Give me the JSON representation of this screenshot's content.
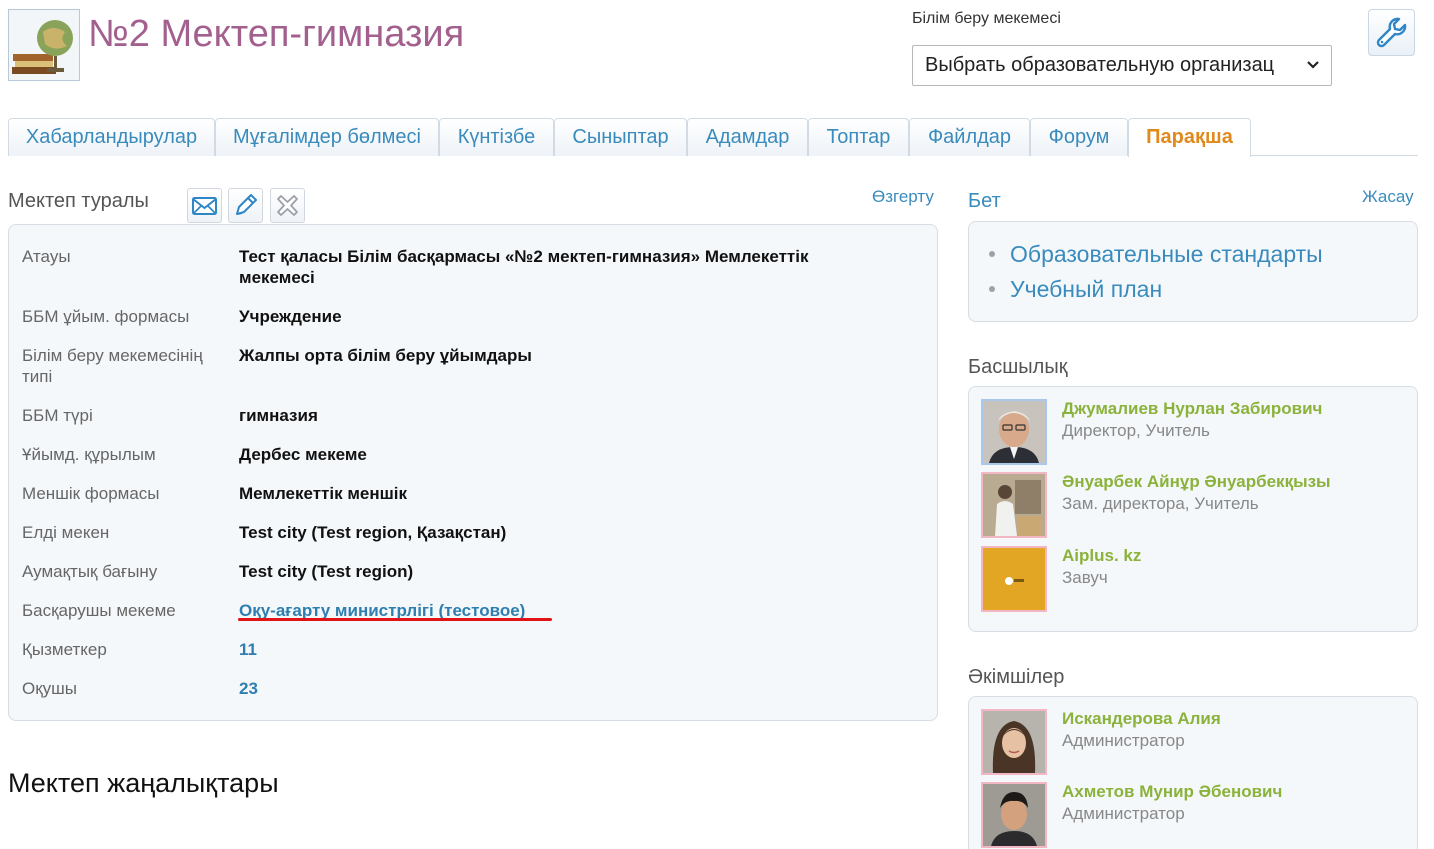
{
  "header": {
    "school_name": "№2 Мектеп-гимназия",
    "org_label": "Білім беру мекемесі",
    "org_select_value": "Выбрать образовательную организац"
  },
  "tabs": [
    {
      "label": "Хабарландырулар",
      "active": false
    },
    {
      "label": "Мұғалімдер бөлмесі",
      "active": false
    },
    {
      "label": "Күнтізбе",
      "active": false
    },
    {
      "label": "Сыныптар",
      "active": false
    },
    {
      "label": "Адамдар",
      "active": false
    },
    {
      "label": "Топтар",
      "active": false
    },
    {
      "label": "Файлдар",
      "active": false
    },
    {
      "label": "Форум",
      "active": false
    },
    {
      "label": "Парақша",
      "active": true
    }
  ],
  "school_info": {
    "title": "Мектеп туралы",
    "edit_label": "Өзгерту",
    "rows": [
      {
        "label": "Атауы",
        "value": "Тест қаласы Білім басқармасы «№2 мектеп-гимназия» Мемлекеттік мекемесі"
      },
      {
        "label": "ББМ ұйым. формасы",
        "value": "Учреждение"
      },
      {
        "label": "Білім беру мекемесінің типі",
        "value": "Жалпы орта білім беру ұйымдары"
      },
      {
        "label": "ББМ түрі",
        "value": "гимназия"
      },
      {
        "label": "Ұйымд. құрылым",
        "value": "Дербес мекеме"
      },
      {
        "label": "Меншік формасы",
        "value": "Мемлекеттік меншік"
      },
      {
        "label": "Елді мекен",
        "value": "Test city (Test region, Қазақстан)"
      },
      {
        "label": "Аумақтық бағыну",
        "value": "Test city (Test region)"
      },
      {
        "label": "Басқарушы мекеме",
        "value": "Оқу-ағарту министрлігі (тестовое)"
      },
      {
        "label": "Қызметкер",
        "value": "11"
      },
      {
        "label": "Оқушы",
        "value": "23"
      }
    ]
  },
  "news": {
    "title": "Мектеп жаңалықтары"
  },
  "pages": {
    "title": "Бет",
    "create_label": "Жасау",
    "items": [
      "Образовательные стандарты",
      "Учебный план"
    ]
  },
  "leadership": {
    "title": "Басшылық",
    "people": [
      {
        "name": "Джумалиев Нурлан Забирович",
        "role": "Директор, Учитель"
      },
      {
        "name": "Әнуарбек Айнұр Әнуарбекқызы",
        "role": "Зам. директора, Учитель"
      },
      {
        "name": "Aiplus. kz",
        "role": "Завуч"
      }
    ]
  },
  "admins": {
    "title": "Әкімшілер",
    "people": [
      {
        "name": "Искандерова Алия",
        "role": "Администратор"
      },
      {
        "name": "Ахметов Мунир Әбенович",
        "role": "Администратор"
      }
    ]
  },
  "colors": {
    "title": "#a3608f",
    "link": "#3a8bbd",
    "active_tab": "#e08a1e",
    "person_name": "#8bb23a",
    "highlight_underline": "#e01414"
  }
}
